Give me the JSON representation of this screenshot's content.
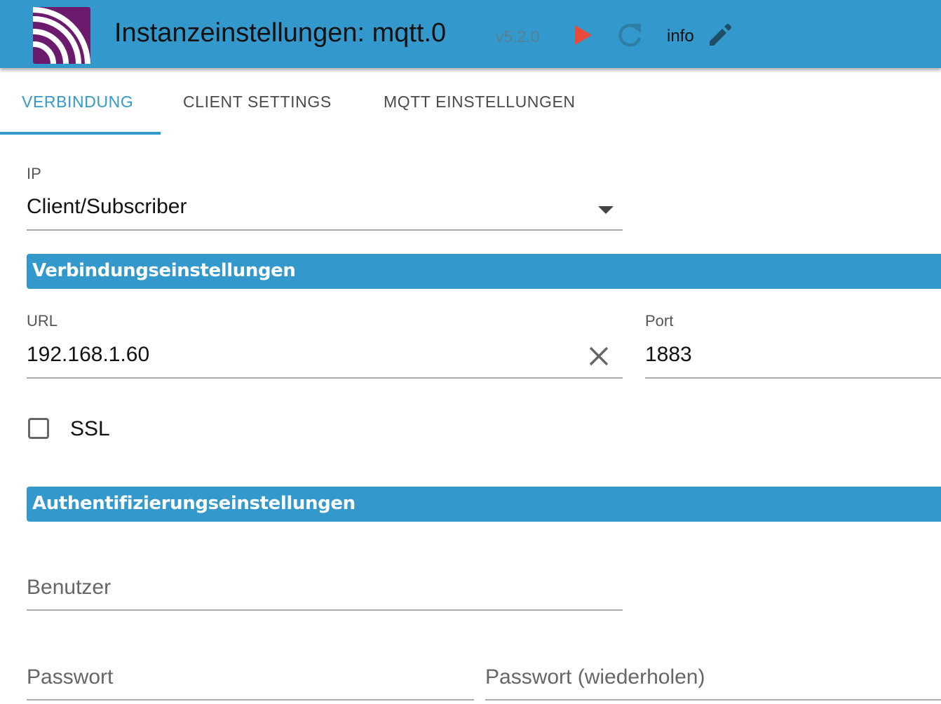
{
  "header": {
    "title": "Instanzeinstellungen: mqtt.0",
    "version": "v5.2.0",
    "info_label": "info",
    "play_color": "#E84A3C",
    "accent_color": "#3399CC",
    "logo_colors": {
      "background": "#6B1A6E",
      "waves": "#ffffff"
    }
  },
  "tabs": [
    {
      "label": "VERBINDUNG",
      "active": true
    },
    {
      "label": "CLIENT SETTINGS",
      "active": false
    },
    {
      "label": "MQTT EINSTELLUNGEN",
      "active": false
    }
  ],
  "ip": {
    "label": "IP",
    "value": "Client/Subscriber"
  },
  "sections": {
    "connection": "Verbindungseinstellungen",
    "auth": "Authentifizierungseinstellungen"
  },
  "connection": {
    "url_label": "URL",
    "url_value": "192.168.1.60",
    "port_label": "Port",
    "port_value": "1883",
    "ssl_label": "SSL",
    "ssl_checked": false
  },
  "auth": {
    "user_placeholder": "Benutzer",
    "password_placeholder": "Passwort",
    "password_repeat_placeholder": "Passwort (wiederholen)"
  }
}
